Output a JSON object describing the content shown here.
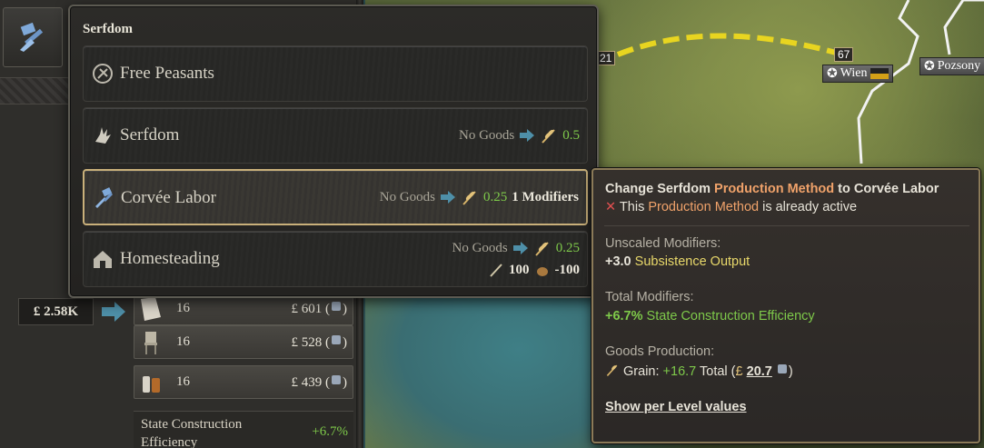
{
  "popup": {
    "title": "Serfdom",
    "items": [
      {
        "name": "Free Peasants",
        "icon": "peasant-icon"
      },
      {
        "name": "Serfdom",
        "icon": "hand-icon",
        "input": "No Goods",
        "output": "0.5"
      },
      {
        "name": "Corvée Labor",
        "icon": "tools-icon",
        "input": "No Goods",
        "output": "0.25",
        "extra": "1 Modifiers",
        "active": true
      },
      {
        "name": "Homesteading",
        "icon": "house-icon",
        "input": "No Goods",
        "output": "0.25",
        "wheat": "100",
        "grain": "-100"
      }
    ]
  },
  "tooltip": {
    "line1_a": "Change Serfdom ",
    "line1_b": "Production Method",
    "line1_c": " to ",
    "line1_d": "Corvée Labor",
    "line2_a": " This ",
    "line2_b": "Production Method",
    "line2_c": " is already active",
    "unscaled_label": "Unscaled Modifiers:",
    "unscaled_val": "+3.0",
    "unscaled_name": " Subsistence Output",
    "total_label": "Total Modifiers:",
    "total_val": "+6.7%",
    "total_name": " State Construction Efficiency",
    "goods_label": "Goods Production:",
    "grain_a": "Grain: ",
    "grain_val": "+16.7",
    "grain_b": " Total (",
    "grain_money": "20.7",
    "grain_c": ")",
    "link": "Show per Level values"
  },
  "left": {
    "money": "£ 2.58K",
    "rows": [
      {
        "qty": "16",
        "price": "£ 601 (",
        "price_end": ")"
      },
      {
        "qty": "16",
        "price": "£ 528 (",
        "price_end": ")"
      },
      {
        "qty": "16",
        "price": "£ 439 (",
        "price_end": ")"
      }
    ],
    "sce_label": "State Construction Efficiency",
    "sce_value": "+6.7%"
  },
  "map": {
    "city1": "Wien",
    "city1_pop": "67",
    "city2": "Pozsony",
    "left_tag": "21"
  },
  "colors": {
    "accent": "#f0a26a",
    "positive": "#7ec94a",
    "gold_border": "#c9b07a"
  }
}
